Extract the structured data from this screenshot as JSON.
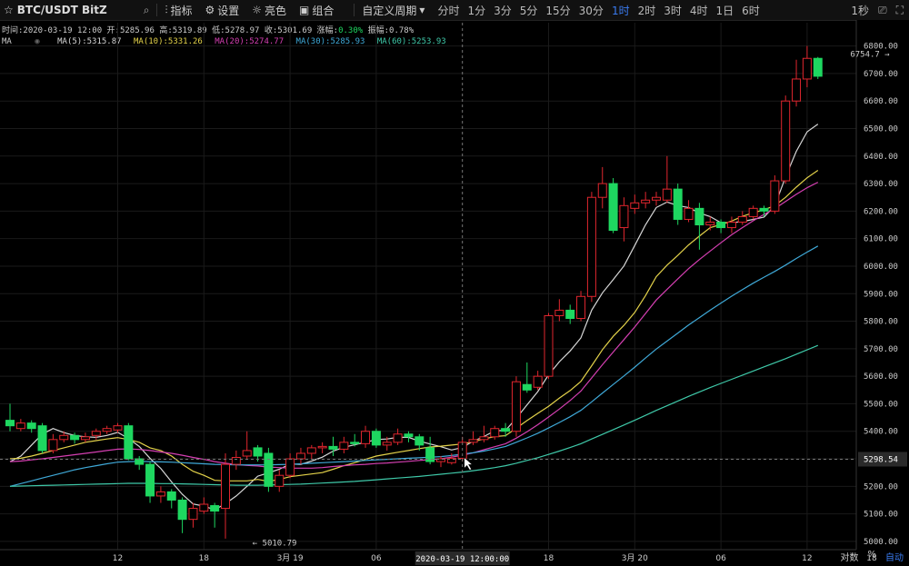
{
  "toolbar": {
    "star_icon": "star-icon",
    "pair": "BTC/USDT BitZ",
    "search_icon": "search-icon",
    "tools": [
      {
        "label": "指标",
        "icon": "chart-icon"
      },
      {
        "label": "设置",
        "icon": "gear-icon"
      },
      {
        "label": "亮色",
        "icon": "sun-icon"
      },
      {
        "label": "组合",
        "icon": "layout-icon"
      }
    ],
    "period_menu": "自定义周期",
    "intervals": [
      "分时",
      "1分",
      "3分",
      "5分",
      "15分",
      "30分",
      "1时",
      "2时",
      "3时",
      "4时",
      "1日",
      "6时"
    ],
    "active_interval": "1时",
    "right_label": "1秒",
    "camera_icon": "camera-icon",
    "fullscreen_icon": "fullscreen-icon"
  },
  "info_line": {
    "time": "时间:2020-03-19 12:00",
    "open": "开:5285.96",
    "high": "高:5319.89",
    "low": "低:5278.97",
    "close": "收:5301.69",
    "change_label": "涨幅:",
    "change_value": "0.30%",
    "amplitude": "振幅:0.78%"
  },
  "ma_line": {
    "label": "MA",
    "items": [
      {
        "text": "MA(5):5315.87",
        "color": "#d8d8d8"
      },
      {
        "text": "MA(10):5331.26",
        "color": "#e3d24a"
      },
      {
        "text": "MA(20):5274.77",
        "color": "#d53fb2"
      },
      {
        "text": "MA(30):5285.93",
        "color": "#3fa9d8"
      },
      {
        "text": "MA(60):5253.93",
        "color": "#3fc9a9"
      }
    ]
  },
  "colors": {
    "up": "#e0262e",
    "down": "#1ed760",
    "grid": "#1a1a1a",
    "axis_text": "#cccccc"
  },
  "bottom_right": {
    "label1": "对数",
    "label2": "%",
    "label3": "自动"
  },
  "chart_data": {
    "type": "candlestick",
    "ylim": [
      4970,
      6835
    ],
    "y_ticks": [
      5000,
      5100,
      5200,
      5300,
      5400,
      5500,
      5600,
      5700,
      5800,
      5900,
      6000,
      6100,
      6200,
      6300,
      6400,
      6500,
      6600,
      6700,
      6800
    ],
    "x_ticks": [
      {
        "index": 10,
        "label": "12"
      },
      {
        "index": 18,
        "label": "18"
      },
      {
        "index": 26,
        "label": "3月 19"
      },
      {
        "index": 34,
        "label": "06"
      },
      {
        "index": 50,
        "label": "18"
      },
      {
        "index": 58,
        "label": "3月 20"
      },
      {
        "index": 66,
        "label": "06"
      },
      {
        "index": 74,
        "label": "12"
      },
      {
        "index": 80,
        "label": "18"
      }
    ],
    "crosshair": {
      "index": 42,
      "price": 5298.54,
      "price_label": "5298.54",
      "date_label": "2020-03-19 12:00:00"
    },
    "annotations": [
      {
        "type": "low",
        "index": 22,
        "value": 5010.79,
        "label": "← 5010.79"
      },
      {
        "type": "high",
        "index": 82,
        "value": 6754.7,
        "label": "6754.7 →"
      }
    ],
    "candles": [
      [
        5440,
        5420,
        5500,
        5400
      ],
      [
        5410,
        5430,
        5445,
        5400
      ],
      [
        5430,
        5410,
        5440,
        5395
      ],
      [
        5420,
        5330,
        5430,
        5320
      ],
      [
        5330,
        5370,
        5390,
        5320
      ],
      [
        5370,
        5385,
        5400,
        5360
      ],
      [
        5385,
        5370,
        5395,
        5355
      ],
      [
        5370,
        5380,
        5395,
        5360
      ],
      [
        5385,
        5400,
        5410,
        5370
      ],
      [
        5400,
        5410,
        5420,
        5390
      ],
      [
        5405,
        5420,
        5430,
        5395
      ],
      [
        5420,
        5300,
        5430,
        5295
      ],
      [
        5300,
        5280,
        5310,
        5260
      ],
      [
        5280,
        5165,
        5290,
        5140
      ],
      [
        5165,
        5180,
        5200,
        5140
      ],
      [
        5180,
        5150,
        5190,
        5120
      ],
      [
        5150,
        5080,
        5160,
        5030
      ],
      [
        5080,
        5120,
        5140,
        5050
      ],
      [
        5110,
        5135,
        5160,
        5100
      ],
      [
        5130,
        5110,
        5140,
        5050
      ],
      [
        5120,
        5280,
        5320,
        5010
      ],
      [
        5280,
        5305,
        5330,
        5260
      ],
      [
        5310,
        5330,
        5400,
        5300
      ],
      [
        5340,
        5310,
        5350,
        5290
      ],
      [
        5320,
        5200,
        5340,
        5180
      ],
      [
        5200,
        5240,
        5260,
        5180
      ],
      [
        5240,
        5300,
        5320,
        5230
      ],
      [
        5300,
        5320,
        5340,
        5280
      ],
      [
        5320,
        5340,
        5350,
        5300
      ],
      [
        5340,
        5345,
        5360,
        5320
      ],
      [
        5345,
        5335,
        5380,
        5310
      ],
      [
        5335,
        5360,
        5380,
        5320
      ],
      [
        5360,
        5355,
        5390,
        5345
      ],
      [
        5355,
        5400,
        5420,
        5340
      ],
      [
        5400,
        5350,
        5410,
        5340
      ],
      [
        5350,
        5360,
        5380,
        5330
      ],
      [
        5360,
        5390,
        5410,
        5350
      ],
      [
        5390,
        5380,
        5400,
        5360
      ],
      [
        5380,
        5350,
        5390,
        5330
      ],
      [
        5340,
        5290,
        5380,
        5280
      ],
      [
        5290,
        5300,
        5310,
        5270
      ],
      [
        5286,
        5302,
        5320,
        5279
      ],
      [
        5302,
        5360,
        5380,
        5290
      ],
      [
        5360,
        5370,
        5400,
        5350
      ],
      [
        5370,
        5380,
        5420,
        5360
      ],
      [
        5380,
        5410,
        5420,
        5370
      ],
      [
        5410,
        5400,
        5430,
        5380
      ],
      [
        5400,
        5580,
        5600,
        5380
      ],
      [
        5570,
        5550,
        5650,
        5540
      ],
      [
        5560,
        5600,
        5620,
        5550
      ],
      [
        5600,
        5820,
        5830,
        5590
      ],
      [
        5820,
        5840,
        5880,
        5800
      ],
      [
        5840,
        5810,
        5860,
        5790
      ],
      [
        5810,
        5890,
        5910,
        5800
      ],
      [
        5890,
        6250,
        6270,
        5870
      ],
      [
        6250,
        6300,
        6360,
        6210
      ],
      [
        6300,
        6130,
        6320,
        6120
      ],
      [
        6140,
        6220,
        6250,
        6090
      ],
      [
        6210,
        6230,
        6260,
        6190
      ],
      [
        6230,
        6240,
        6270,
        6210
      ],
      [
        6240,
        6250,
        6270,
        6220
      ],
      [
        6240,
        6280,
        6400,
        6230
      ],
      [
        6280,
        6170,
        6300,
        6150
      ],
      [
        6170,
        6210,
        6240,
        6160
      ],
      [
        6210,
        6150,
        6230,
        6060
      ],
      [
        6150,
        6160,
        6180,
        6130
      ],
      [
        6160,
        6140,
        6170,
        6120
      ],
      [
        6140,
        6160,
        6180,
        6120
      ],
      [
        6160,
        6180,
        6200,
        6150
      ],
      [
        6180,
        6210,
        6220,
        6170
      ],
      [
        6210,
        6200,
        6220,
        6180
      ],
      [
        6200,
        6310,
        6330,
        6190
      ],
      [
        6310,
        6600,
        6620,
        6300
      ],
      [
        6600,
        6680,
        6750,
        6580
      ],
      [
        6680,
        6755,
        6800,
        6650
      ],
      [
        6755,
        6690,
        6760,
        6680
      ]
    ],
    "ma_series": [
      {
        "name": "MA(5)",
        "values": [
          5290,
          5310,
          5350,
          5390,
          5410,
          5395,
          5385,
          5380,
          5378,
          5385,
          5396,
          5374,
          5345,
          5302,
          5265,
          5216,
          5171,
          5136,
          5128,
          5115,
          5137,
          5165,
          5200,
          5237,
          5249,
          5262,
          5281,
          5280,
          5292,
          5306,
          5328,
          5342,
          5351,
          5360,
          5370,
          5372,
          5378,
          5378,
          5364,
          5354,
          5344,
          5332,
          5341,
          5364,
          5381,
          5402,
          5403,
          5447,
          5496,
          5544,
          5605,
          5653,
          5692,
          5739,
          5840,
          5903,
          5951,
          6001,
          6075,
          6150,
          6213,
          6233,
          6220,
          6213,
          6193,
          6180,
          6158,
          6158,
          6162,
          6170,
          6178,
          6220,
          6324,
          6417,
          6488,
          6516
        ]
      },
      {
        "name": "MA(10)",
        "values": [
          5300,
          5302,
          5310,
          5320,
          5330,
          5340,
          5350,
          5360,
          5366,
          5372,
          5377,
          5370,
          5360,
          5340,
          5330,
          5310,
          5280,
          5255,
          5240,
          5222,
          5220,
          5220,
          5220,
          5225,
          5218,
          5225,
          5235,
          5240,
          5245,
          5250,
          5262,
          5275,
          5286,
          5298,
          5310,
          5317,
          5324,
          5330,
          5337,
          5343,
          5346,
          5350,
          5354,
          5362,
          5372,
          5381,
          5384,
          5411,
          5439,
          5465,
          5491,
          5521,
          5548,
          5581,
          5638,
          5697,
          5745,
          5785,
          5832,
          5893,
          5962,
          6004,
          6039,
          6077,
          6109,
          6140,
          6151,
          6164,
          6181,
          6194,
          6205,
          6220,
          6250,
          6287,
          6321,
          6348
        ]
      },
      {
        "name": "MA(20)",
        "values": [
          5290,
          5292,
          5296,
          5300,
          5305,
          5310,
          5315,
          5320,
          5325,
          5330,
          5335,
          5336,
          5334,
          5330,
          5325,
          5320,
          5313,
          5305,
          5298,
          5290,
          5284,
          5279,
          5276,
          5274,
          5270,
          5268,
          5266,
          5266,
          5266,
          5268,
          5272,
          5275,
          5278,
          5280,
          5283,
          5285,
          5288,
          5291,
          5294,
          5297,
          5300,
          5306,
          5313,
          5322,
          5333,
          5344,
          5355,
          5375,
          5398,
          5424,
          5452,
          5481,
          5512,
          5546,
          5594,
          5642,
          5688,
          5733,
          5779,
          5828,
          5877,
          5916,
          5954,
          5991,
          6024,
          6055,
          6085,
          6114,
          6140,
          6165,
          6188,
          6209,
          6235,
          6261,
          6285,
          6305
        ]
      },
      {
        "name": "MA(30)",
        "values": [
          5200,
          5210,
          5220,
          5230,
          5240,
          5250,
          5260,
          5268,
          5275,
          5282,
          5288,
          5290,
          5291,
          5290,
          5289,
          5288,
          5286,
          5284,
          5282,
          5280,
          5279,
          5278,
          5278,
          5278,
          5278,
          5279,
          5280,
          5282,
          5284,
          5286,
          5288,
          5290,
          5292,
          5294,
          5296,
          5298,
          5300,
          5302,
          5304,
          5306,
          5308,
          5312,
          5317,
          5322,
          5328,
          5336,
          5345,
          5360,
          5376,
          5393,
          5412,
          5432,
          5453,
          5476,
          5507,
          5539,
          5570,
          5601,
          5633,
          5666,
          5699,
          5728,
          5757,
          5786,
          5813,
          5840,
          5866,
          5891,
          5915,
          5938,
          5960,
          5981,
          6004,
          6028,
          6051,
          6073
        ]
      },
      {
        "name": "MA(60)",
        "values": [
          5200,
          5201,
          5202,
          5203,
          5204,
          5205,
          5206,
          5207,
          5208,
          5209,
          5210,
          5211,
          5211,
          5211,
          5210,
          5210,
          5209,
          5208,
          5207,
          5206,
          5205,
          5204,
          5204,
          5204,
          5205,
          5206,
          5207,
          5208,
          5210,
          5212,
          5214,
          5216,
          5218,
          5221,
          5224,
          5227,
          5230,
          5233,
          5236,
          5240,
          5244,
          5248,
          5252,
          5257,
          5262,
          5268,
          5275,
          5284,
          5294,
          5304,
          5316,
          5328,
          5341,
          5355,
          5372,
          5389,
          5406,
          5423,
          5440,
          5458,
          5476,
          5493,
          5510,
          5527,
          5543,
          5559,
          5574,
          5589,
          5604,
          5619,
          5634,
          5649,
          5664,
          5680,
          5696,
          5712
        ]
      }
    ]
  }
}
